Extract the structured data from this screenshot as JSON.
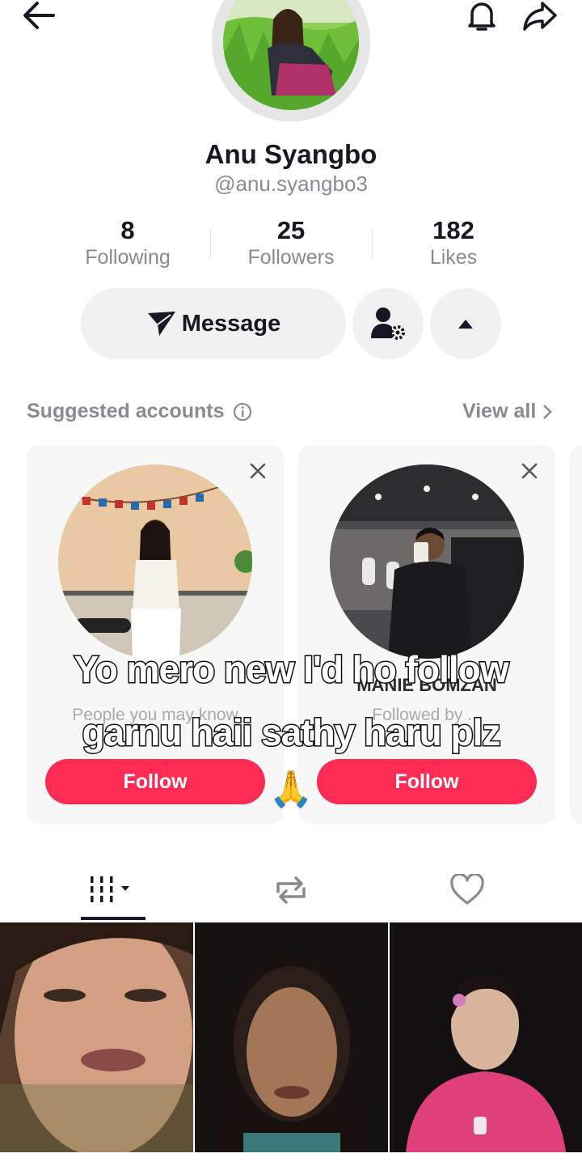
{
  "profile": {
    "name": "Anu Syangbo",
    "handle": "@anu.syangbo3"
  },
  "stats": [
    {
      "value": "8",
      "label": "Following"
    },
    {
      "value": "25",
      "label": "Followers"
    },
    {
      "value": "182",
      "label": "Likes"
    }
  ],
  "actions": {
    "message_label": "Message"
  },
  "suggested": {
    "title": "Suggested accounts",
    "view_all": "View all",
    "cards": [
      {
        "name": "",
        "subtitle": "People you may know",
        "follow_label": "Follow"
      },
      {
        "name": "MANIE BOMZAN",
        "subtitle": "Followed by ...",
        "follow_label": "Follow"
      }
    ]
  },
  "caption": {
    "line1": "Yo mero new I'd ho follow",
    "line2": "garnu haii sathy haru plz",
    "emoji": "🙏"
  },
  "tabs": [
    {
      "icon": "videos-grid-icon",
      "active": true
    },
    {
      "icon": "repost-icon",
      "active": false
    },
    {
      "icon": "heart-icon",
      "active": false
    }
  ],
  "colors": {
    "accent": "#fe2c55",
    "text": "#161823",
    "secondary_text": "#8a8b91",
    "button_bg": "#f1f1f2"
  }
}
